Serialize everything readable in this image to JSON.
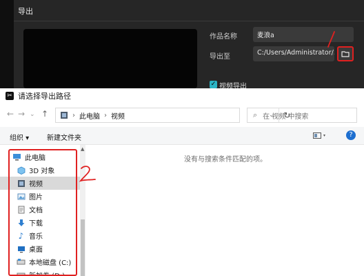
{
  "export_panel": {
    "title": "导出",
    "name_label": "作品名称",
    "name_value": "麦浪a",
    "export_to_label": "导出至",
    "export_path": "C:/Users/Administrator/...",
    "video_export_label": "视频导出",
    "annotation_1": "1"
  },
  "dialog": {
    "title": "请选择导出路径",
    "address": [
      "此电脑",
      "视频"
    ],
    "search_placeholder": "在 视频 中搜索",
    "organize_label": "组织 ▾",
    "new_folder_label": "新建文件夹",
    "empty_message": "没有与搜索条件匹配的项。",
    "annotation_2": "2"
  },
  "sidebar": {
    "items": [
      {
        "label": "此电脑",
        "icon": "pc-icon"
      },
      {
        "label": "3D 对象",
        "icon": "3d-objects-icon"
      },
      {
        "label": "视频",
        "icon": "video-icon"
      },
      {
        "label": "图片",
        "icon": "pictures-icon"
      },
      {
        "label": "文档",
        "icon": "documents-icon"
      },
      {
        "label": "下载",
        "icon": "download-icon"
      },
      {
        "label": "音乐",
        "icon": "music-icon"
      },
      {
        "label": "桌面",
        "icon": "desktop-icon"
      },
      {
        "label": "本地磁盘 (C:)",
        "icon": "drive-icon"
      },
      {
        "label": "新加卷 (D:)",
        "icon": "drive-icon"
      }
    ]
  },
  "colors": {
    "accent": "#2bb4c4",
    "highlight": "#e02020"
  }
}
